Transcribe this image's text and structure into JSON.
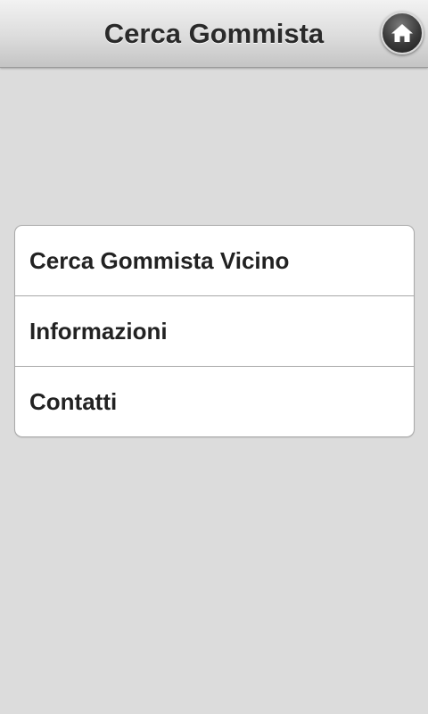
{
  "header": {
    "title": "Cerca Gommista",
    "home_icon": "home-icon"
  },
  "menu": {
    "items": [
      {
        "label": "Cerca Gommista Vicino"
      },
      {
        "label": "Informazioni"
      },
      {
        "label": "Contatti"
      }
    ]
  },
  "colors": {
    "background": "#dcdcdc",
    "header_text": "#2a2a2a",
    "list_background": "#ffffff",
    "list_border": "#a8a8a8",
    "item_text": "#222222"
  }
}
